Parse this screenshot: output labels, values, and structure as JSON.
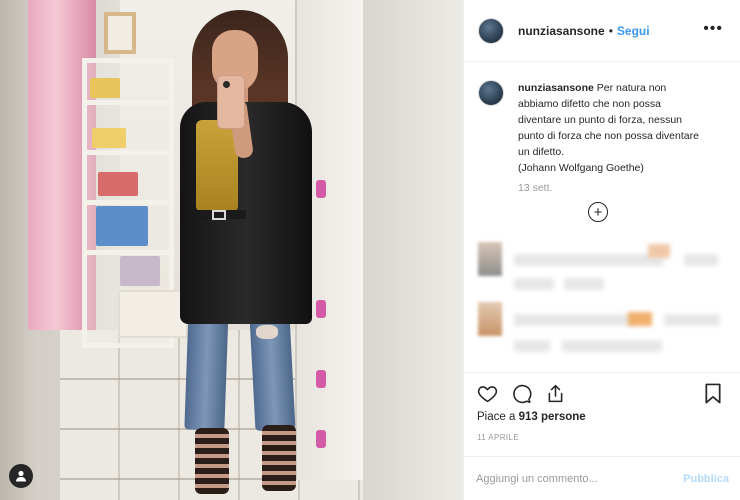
{
  "post": {
    "username": "nunziasansone",
    "separator": "•",
    "follow_label": "Segui",
    "more_label": "•••",
    "caption_user": "nunziasansone",
    "caption_text": " Per natura non\nabbiamo difetto che non possa\ndiventare un punto di forza, nessun\npunto di forza che non possa diventare\nun difetto.\n(Johann Wolfgang Goethe)",
    "caption_date": "13 sett.",
    "load_more_symbol": "+",
    "likes_prefix": "Piace a ",
    "likes_count": "913 persone",
    "post_date": "11 APRILE",
    "comment_placeholder": "Aggiungi un commento...",
    "publish_label": "Pubblica"
  },
  "icons": {
    "like": "heart-icon",
    "comment": "comment-icon",
    "share": "share-icon",
    "save": "bookmark-icon",
    "image_user": "user-tag-icon",
    "more": "more-options-icon",
    "load_more": "plus-circle-icon"
  },
  "colors": {
    "link_blue": "#3897f0",
    "publish_disabled": "#b3dbff",
    "text": "#262626",
    "muted": "#999999"
  }
}
